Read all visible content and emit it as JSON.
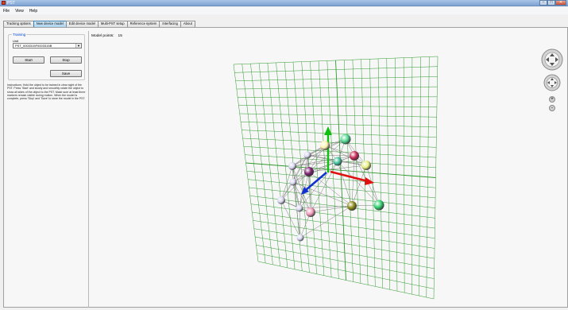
{
  "window": {
    "title": "PST"
  },
  "menu": [
    "File",
    "View",
    "Help"
  ],
  "tabs": [
    {
      "label": "Tracking options",
      "active": false
    },
    {
      "label": "New device model",
      "active": true
    },
    {
      "label": "Edit device model",
      "active": false
    },
    {
      "label": "Multi-PST setup",
      "active": false
    },
    {
      "label": "Reference system",
      "active": false
    },
    {
      "label": "Interfacing",
      "active": false
    },
    {
      "label": "About",
      "active": false
    }
  ],
  "training": {
    "legend": "Training",
    "unit_label": "Unit",
    "unit_value": "PST_0003315F0003315B",
    "start_label": "Start",
    "stop_label": "Stop",
    "save_label": "Save",
    "instructions": "Instructions: Hold the object to be trained in clear sight of the PST. Press 'Start' and slowly and smoothly rotate the object to show all sides of the object to the PST. Make sure at least three markers remain visible during motion. When the model is complete, press 'Stop' and 'Save' to store the model in the PST."
  },
  "viewer": {
    "model_points_label": "Model points:",
    "model_points_value": "15",
    "zoom_in": "+",
    "zoom_out": "-"
  },
  "colors": {
    "grid": "#2f9a2f",
    "axis_x": "#e01010",
    "axis_y": "#10c010",
    "axis_z": "#1030d0",
    "tab_active": "#a9d3f2"
  },
  "icons": [
    "app-icon",
    "rotate-control-icon",
    "pan-control-icon",
    "zoom-in-icon",
    "zoom-out-icon"
  ]
}
